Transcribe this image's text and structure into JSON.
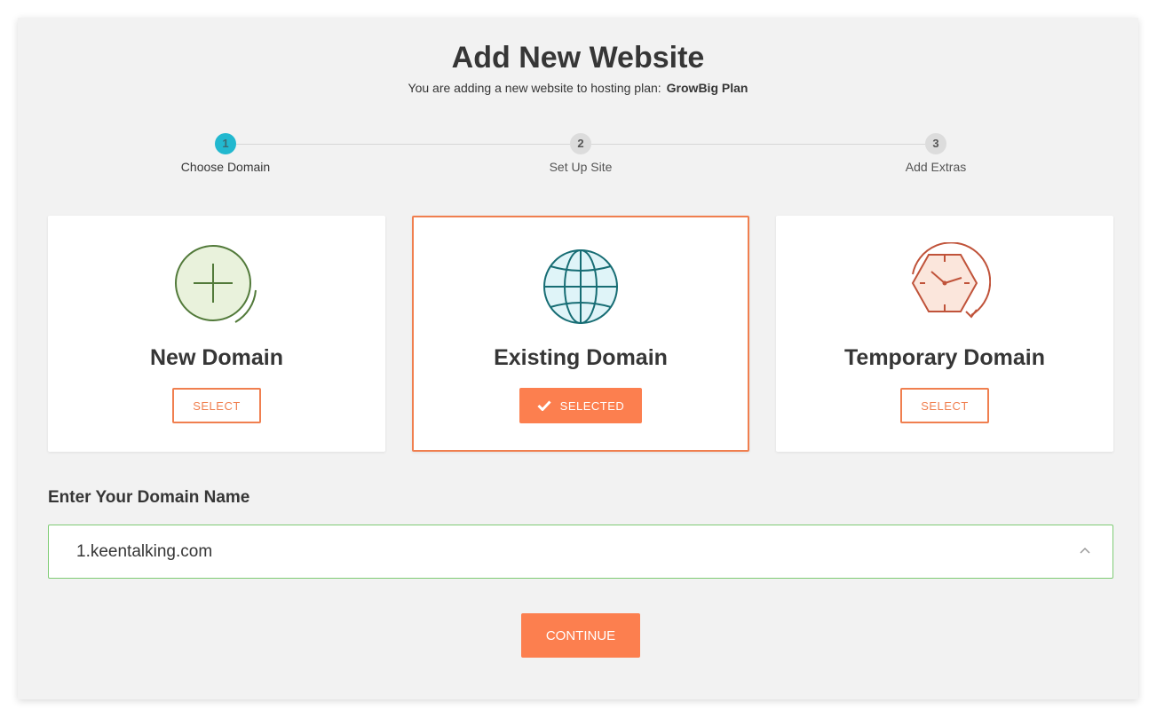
{
  "header": {
    "title": "Add New Website",
    "subtitle_prefix": "You are adding a new website to hosting plan:",
    "plan_name": "GrowBig Plan"
  },
  "stepper": {
    "steps": [
      {
        "number": "1",
        "label": "Choose Domain",
        "active": true
      },
      {
        "number": "2",
        "label": "Set Up Site",
        "active": false
      },
      {
        "number": "3",
        "label": "Add Extras",
        "active": false
      }
    ]
  },
  "options": [
    {
      "title": "New Domain",
      "button_label": "SELECT",
      "icon": "plus-circle-icon",
      "selected": false
    },
    {
      "title": "Existing Domain",
      "button_label": "SELECTED",
      "icon": "globe-icon",
      "selected": true
    },
    {
      "title": "Temporary Domain",
      "button_label": "SELECT",
      "icon": "clock-icon",
      "selected": false
    }
  ],
  "domain": {
    "label": "Enter Your Domain Name",
    "value": "1.keentalking.com"
  },
  "actions": {
    "continue_label": "CONTINUE"
  },
  "colors": {
    "accent": "#fc7f4f",
    "step_active": "#22b8cf",
    "input_border": "#7ecb74",
    "panel_bg": "#f2f2f2"
  }
}
